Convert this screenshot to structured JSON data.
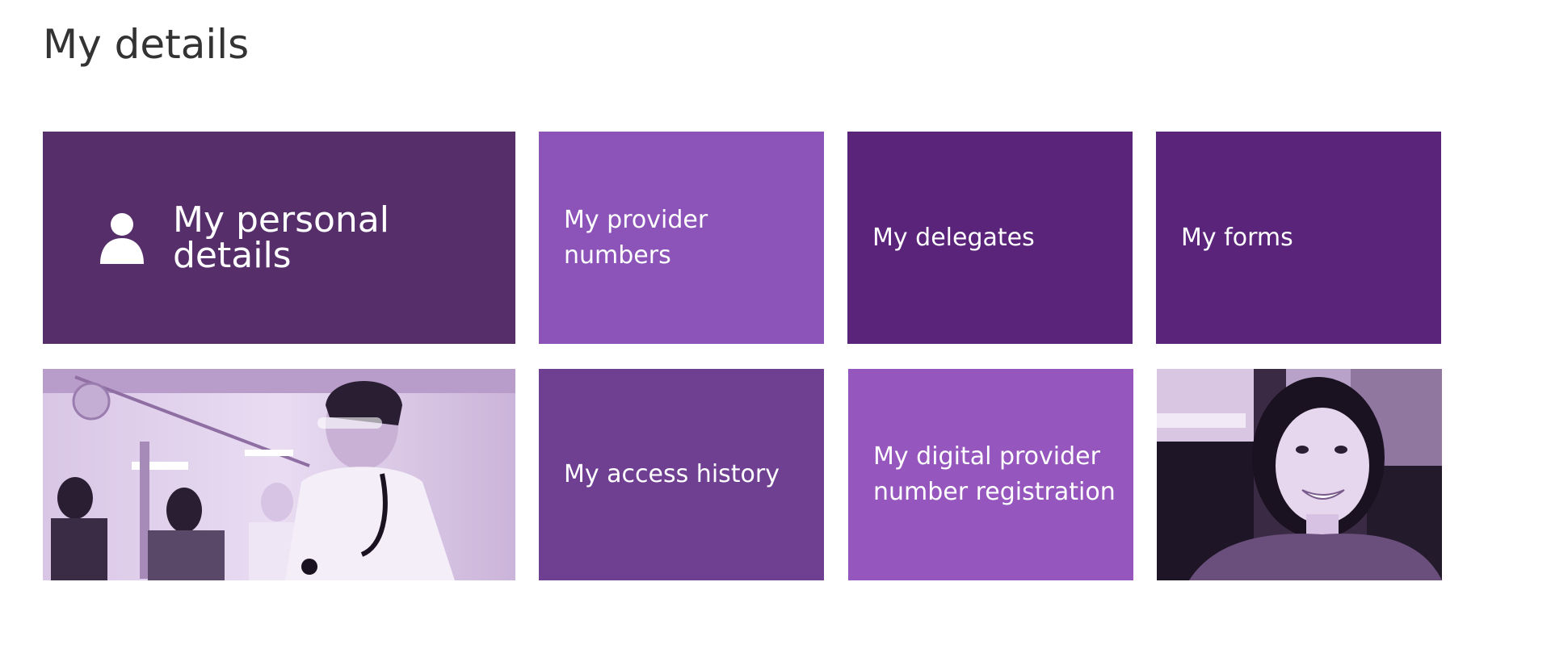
{
  "page": {
    "title": "My details"
  },
  "tiles": {
    "personal_details": {
      "label": "My personal details",
      "icon": "person-icon",
      "color": "#552e6a"
    },
    "provider_numbers": {
      "label": "My provider numbers",
      "color": "#8c54b8"
    },
    "delegates": {
      "label": "My delegates",
      "color": "#5b247b"
    },
    "forms": {
      "label": "My forms",
      "color": "#5b247b"
    },
    "access_history": {
      "label": "My access history",
      "color": "#6f3f92"
    },
    "digital_provider": {
      "label": "My digital provider number registration",
      "color": "#9557bd"
    }
  },
  "images": {
    "medical_staff_photo": "medical-staff-photo",
    "smiling_woman_photo": "smiling-woman-photo"
  }
}
